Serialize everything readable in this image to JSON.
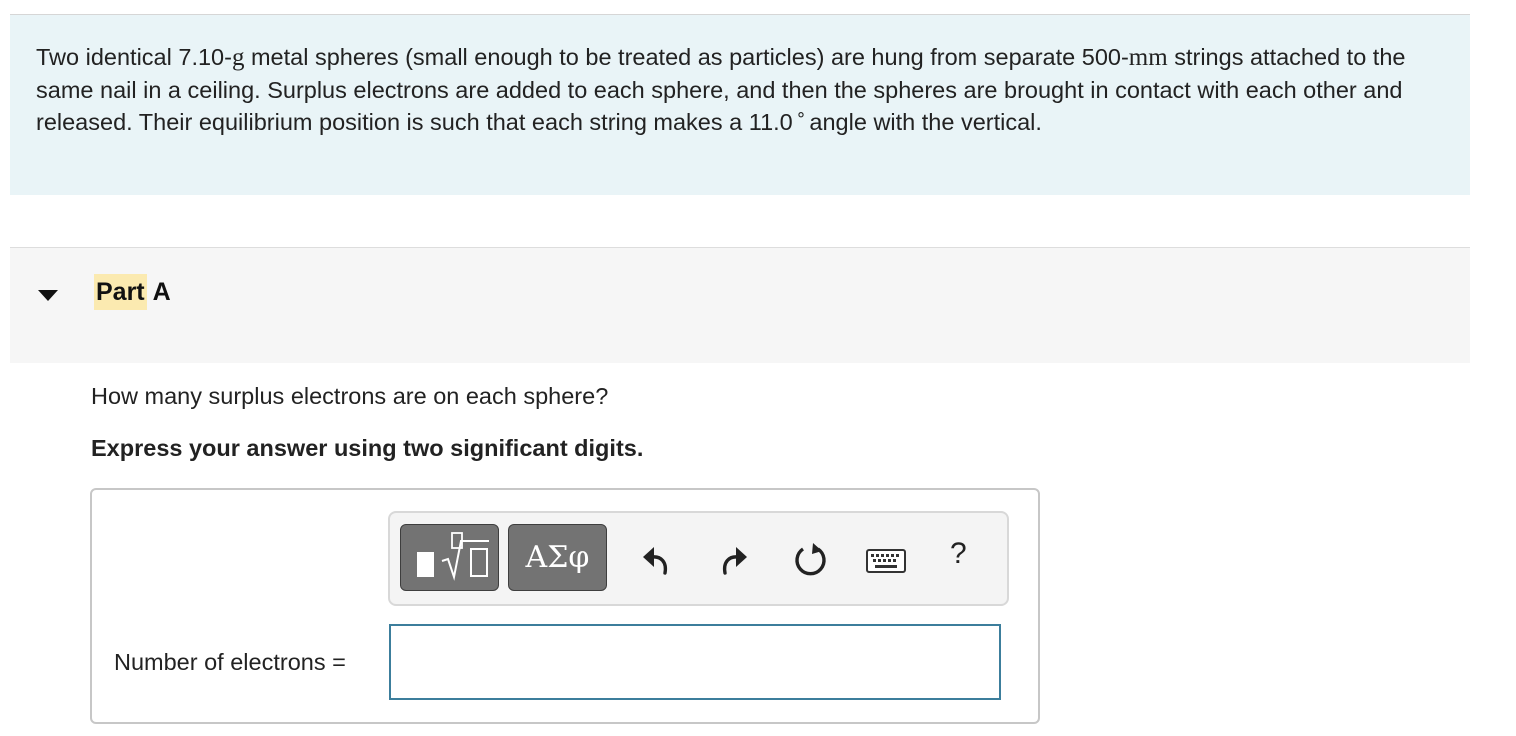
{
  "problem": {
    "intro_part1": "Two identical 7.10-",
    "mass_unit": "g",
    "intro_part2": " metal spheres (small enough to be treated as particles) are hung from separate 500-",
    "length_unit": "mm",
    "intro_part3": " strings attached to the same nail in a ceiling. Surplus electrons are added to each sphere, and then the spheres are brought in contact with each other and released. Their equilibrium position is such that each string makes a 11.0",
    "degree_symbol": "∘",
    "intro_part4": "angle with the vertical."
  },
  "part": {
    "label_highlight": "Part",
    "label_letter": " A",
    "question": "How many surplus electrons are on each sphere?",
    "instruction": "Express your answer using two significant digits."
  },
  "toolbar": {
    "template_icon": "templates-icon",
    "greek_label": "ΑΣφ",
    "undo_icon": "undo-icon",
    "redo_icon": "redo-icon",
    "reset_icon": "reset-icon",
    "keyboard_icon": "keyboard-icon",
    "help_label": "?"
  },
  "answer": {
    "field_label": "Number of electrons =",
    "value": ""
  },
  "colors": {
    "intro_background": "#e9f4f7",
    "part_background": "#f6f6f6",
    "highlight": "#fbeab0",
    "input_border": "#3c7e9c",
    "button_dark": "#737373"
  }
}
